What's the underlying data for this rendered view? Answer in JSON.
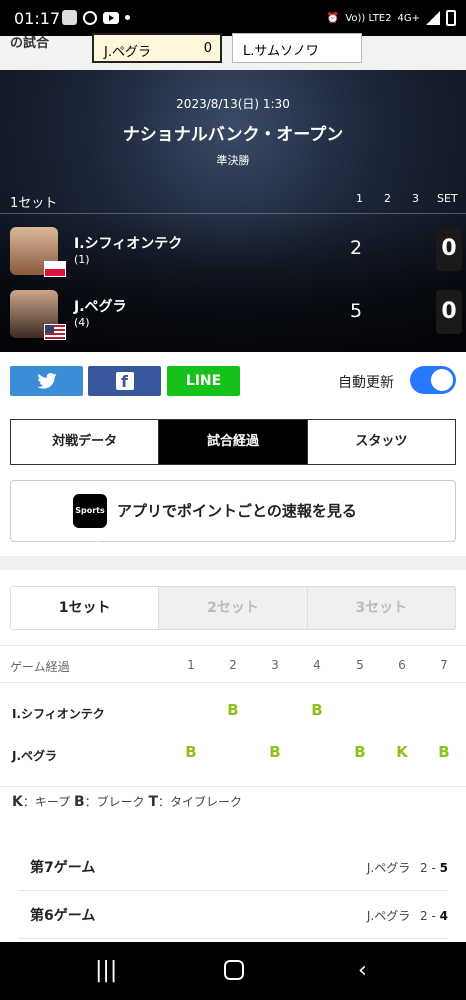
{
  "status": {
    "time": "01:17",
    "network": "Vo)) LTE2",
    "net_type": "4G+"
  },
  "topbar": {
    "cut_label": "の試合",
    "p1": "J.ペグラ",
    "p1_score": "0",
    "p2": "L.サムソノワ"
  },
  "match": {
    "date": "2023/8/13(日) 1:30",
    "tournament": "ナショナルバンク・オープン",
    "round": "準決勝",
    "set_label": "1セット",
    "cols": [
      "1",
      "2",
      "3",
      "SET"
    ],
    "players": [
      {
        "name": "I.シフィオンテク",
        "seed": "(1)",
        "score": "2",
        "sets": "0",
        "flag": "poland"
      },
      {
        "name": "J.ペグラ",
        "seed": "(4)",
        "score": "5",
        "sets": "0",
        "flag": "usa"
      }
    ]
  },
  "share": {
    "twitter": "twitter-icon",
    "facebook": "f",
    "line": "LINE",
    "auto_update": "自動更新",
    "auto_update_on": true
  },
  "tabs": [
    "対戦データ",
    "試合経過",
    "スタッツ"
  ],
  "active_tab": 1,
  "app_banner": {
    "icon_text": "Sports navi",
    "text": "アプリでポイントごとの速報を見る"
  },
  "set_tabs": [
    "1セット",
    "2セット",
    "3セット"
  ],
  "game_table": {
    "header": "ゲーム経過",
    "games": [
      "1",
      "2",
      "3",
      "4",
      "5",
      "6",
      "7"
    ],
    "rows": [
      {
        "name": "I.シフィオンテク",
        "marks": [
          "",
          "B",
          "",
          "B",
          "",
          "",
          ""
        ]
      },
      {
        "name": "J.ペグラ",
        "marks": [
          "B",
          "",
          "B",
          "",
          "B",
          "K",
          "B"
        ]
      }
    ]
  },
  "legend": {
    "k": "K",
    "k_text": "：キープ",
    "b": "B",
    "b_text": "：ブレーク",
    "t": "T",
    "t_text": "：タイブレーク"
  },
  "game_log": [
    {
      "title": "第7ゲーム",
      "player": "J.ペグラ",
      "score": "2 - ",
      "score_bold": "5"
    },
    {
      "title": "第6ゲーム",
      "player": "J.ペグラ",
      "score": "2 - ",
      "score_bold": "4"
    }
  ],
  "colors": {
    "accent_green": "#8bc21e",
    "toggle_blue": "#2979ff",
    "twitter": "#3b8ed6",
    "facebook": "#37589c",
    "line": "#16c11a"
  }
}
